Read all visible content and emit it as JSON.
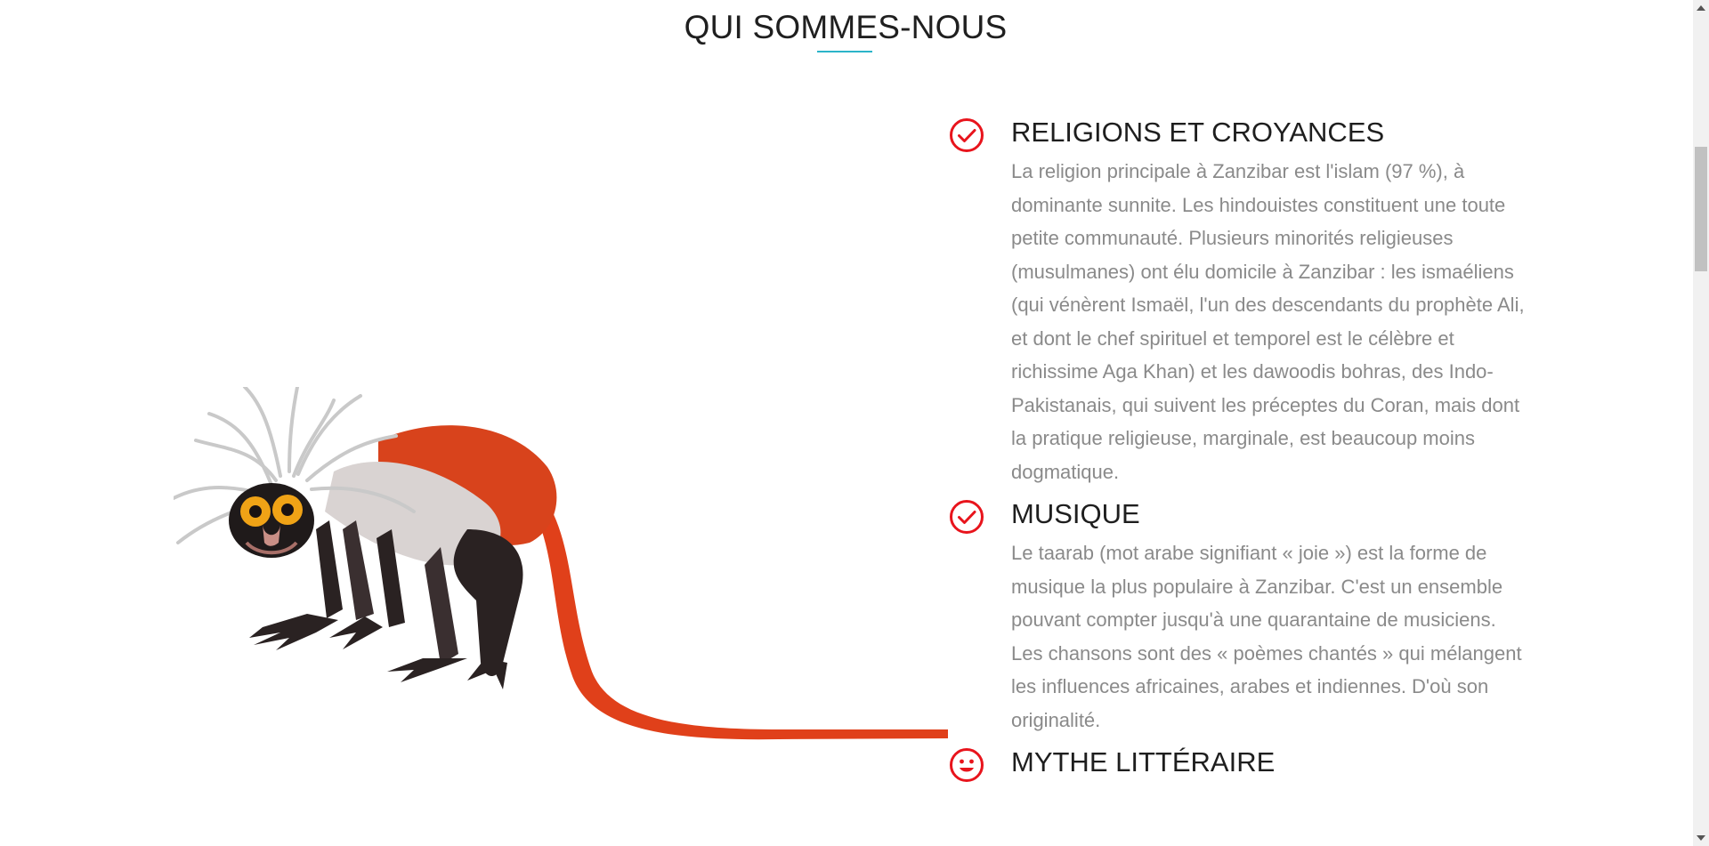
{
  "section": {
    "title": "QUI SOMMES-NOUS",
    "accent_color": "#2bb4c9"
  },
  "illustration": {
    "icon": "monkey-illustration"
  },
  "features": [
    {
      "icon": "check-circle-icon",
      "title": "RELIGIONS ET CROYANCES",
      "text": "La religion principale à Zanzibar est l'islam (97 %), à dominante sunnite. Les hindouistes constituent une toute petite communauté. Plusieurs minorités religieuses (musulmanes) ont élu domicile à Zanzibar : les ismaéliens (qui vénèrent Ismaël, l'un des descendants du prophète Ali, et dont le chef spirituel et temporel est le célèbre et richissime Aga Khan) et les dawoodis bohras, des Indo-Pakistanais, qui suivent les préceptes du Coran, mais dont la pratique religieuse, marginale, est beaucoup moins dogmatique."
    },
    {
      "icon": "check-circle-icon",
      "title": "MUSIQUE",
      "text": "Le taarab (mot arabe signifiant « joie ») est la forme de musique la plus populaire à Zanzibar. C'est un ensemble pouvant compter jusqu'à une quarantaine de musiciens. Les chansons sont des « poèmes chantés » qui mélangent les influences africaines, arabes et indiennes. D'où son originalité."
    },
    {
      "icon": "smiley-circle-icon",
      "title": "MYTHE LITTÉRAIRE",
      "text": ""
    }
  ],
  "colors": {
    "icon_red": "#e8141c",
    "title_text": "#1e1e1e",
    "body_text": "#8a8a8a"
  }
}
